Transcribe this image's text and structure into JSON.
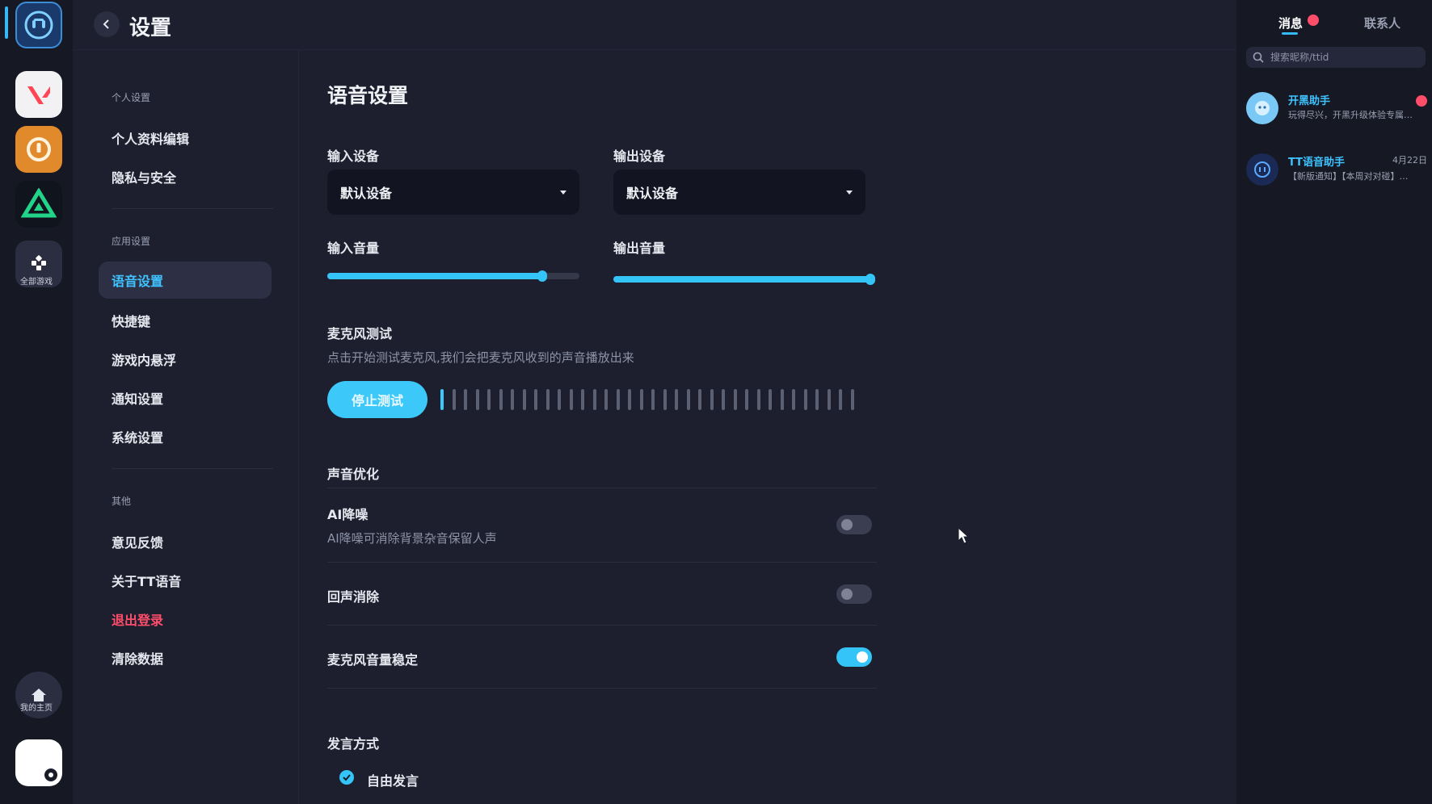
{
  "rail": {
    "apps": [
      {
        "name": "TT语音"
      },
      {
        "name": "无畏契约"
      },
      {
        "name": "守望先锋"
      },
      {
        "name": "英雄联盟"
      }
    ],
    "all_games_label": "全部游戏",
    "home_label": "我的主页"
  },
  "header": {
    "title": "设置"
  },
  "nav": {
    "group_personal": "个人设置",
    "group_app": "应用设置",
    "group_other": "其他",
    "items": {
      "profile": "个人资料编辑",
      "privacy": "隐私与安全",
      "voice": "语音设置",
      "hotkeys": "快捷键",
      "overlay": "游戏内悬浮",
      "notify": "通知设置",
      "system": "系统设置",
      "feedback": "意见反馈",
      "about": "关于TT语音",
      "logout": "退出登录",
      "clear": "清除数据"
    }
  },
  "voice": {
    "title": "语音设置",
    "input_device_label": "输入设备",
    "input_device_value": "默认设备",
    "output_device_label": "输出设备",
    "output_device_value": "默认设备",
    "input_volume_label": "输入音量",
    "input_volume": 0.86,
    "output_volume_label": "输出音量",
    "output_volume": 1.0,
    "mic_test_title": "麦克风测试",
    "mic_test_hint": "点击开始测试麦克风,我们会把麦克风收到的声音播放出来",
    "mic_test_button": "停止测试",
    "mic_level_bars_active": 1,
    "mic_level_bars_total": 36,
    "opt_title": "声音优化",
    "ai_denoise_label": "AI降噪",
    "ai_denoise_hint": "AI降噪可消除背景杂音保留人声",
    "ai_denoise_on": false,
    "echo_cancel_label": "回声消除",
    "echo_cancel_on": false,
    "mic_stable_label": "麦克风音量稳定",
    "mic_stable_on": true,
    "speak_mode_title": "发言方式",
    "speak_mode_value": "自由发言"
  },
  "side": {
    "tab_messages": "消息",
    "tab_contacts": "联系人",
    "search_placeholder": "搜索昵称/ttid",
    "chats": [
      {
        "name": "开黑助手",
        "preview": "玩得尽兴，开黑升级体验专属…",
        "time": ""
      },
      {
        "name": "TT语音助手",
        "preview": "【新版通知】【本周对对碰】…",
        "time": "4月22日"
      }
    ]
  },
  "colors": {
    "accent": "#35c4f7",
    "danger": "#ff4d6a",
    "bg": "#1d1f2e"
  }
}
